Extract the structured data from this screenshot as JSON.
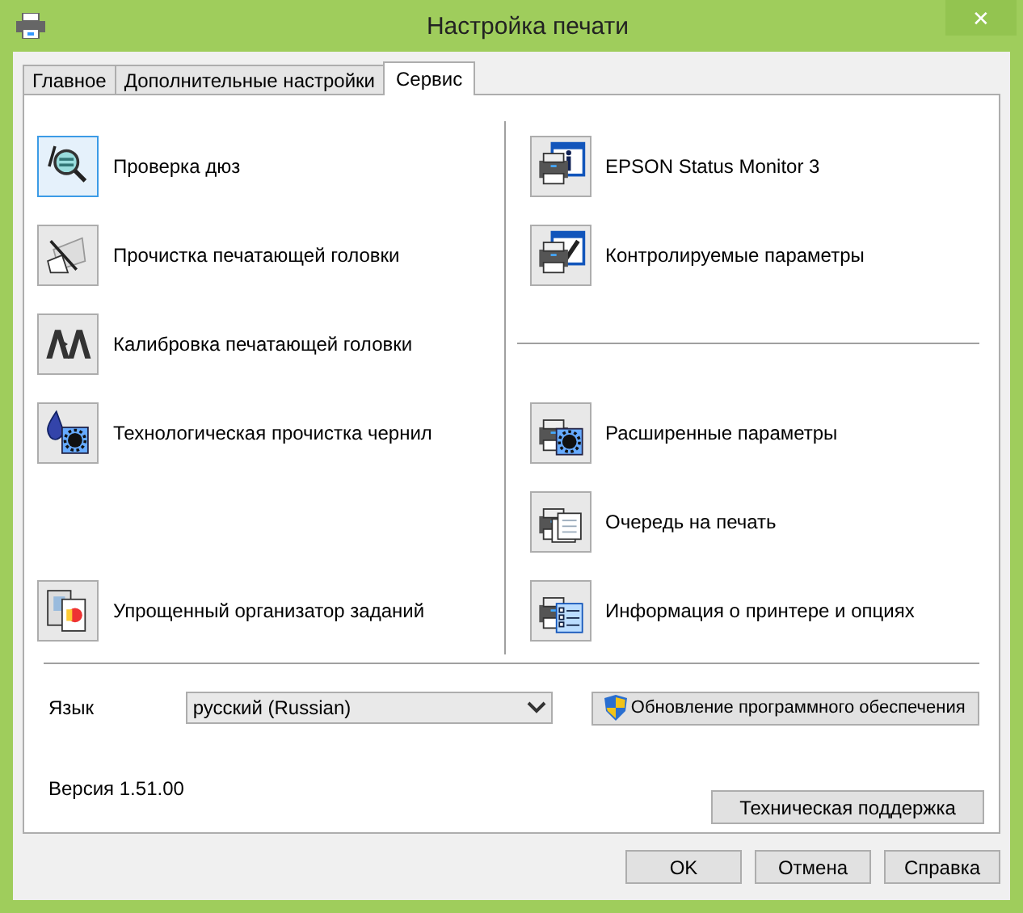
{
  "window": {
    "title": "Настройка печати",
    "close": "✕"
  },
  "tabs": [
    {
      "label": "Главное",
      "selected": false
    },
    {
      "label": "Дополнительные настройки",
      "selected": false
    },
    {
      "label": "Сервис",
      "selected": true
    }
  ],
  "columns": [
    {
      "divided": false,
      "groups": [
        [
          {
            "label": "Проверка дюз",
            "kind": "magnifier",
            "focused": true
          },
          {
            "label": "Прочистка печатающей головки",
            "kind": "brush",
            "focused": false
          },
          {
            "label": "Калибровка печатающей головки",
            "kind": "align",
            "focused": false
          },
          {
            "label": "Технологическая прочистка чернил",
            "kind": "ink-gear",
            "focused": false
          }
        ],
        [
          {
            "label": "Упрощенный организатор заданий",
            "kind": "documents",
            "focused": false
          }
        ]
      ]
    },
    {
      "divided": true,
      "groups": [
        [
          {
            "label": "EPSON Status Monitor 3",
            "kind": "printer-info",
            "focused": false
          },
          {
            "label": "Контролируемые параметры",
            "kind": "printer-check",
            "focused": false
          }
        ],
        [
          {
            "label": "Расширенные параметры",
            "kind": "printer-gear",
            "focused": false
          },
          {
            "label": "Очередь на печать",
            "kind": "printer-queue",
            "focused": false
          },
          {
            "label": "Информация о принтере и опциях",
            "kind": "printer-list",
            "focused": false
          }
        ]
      ]
    }
  ],
  "language": {
    "label": "Язык",
    "value": "русский (Russian)"
  },
  "update_button": "Обновление программного обеспечения",
  "version": "Версия 1.51.00",
  "support_button": "Техническая поддержка",
  "buttons": [
    "OK",
    "Отмена",
    "Справка"
  ]
}
